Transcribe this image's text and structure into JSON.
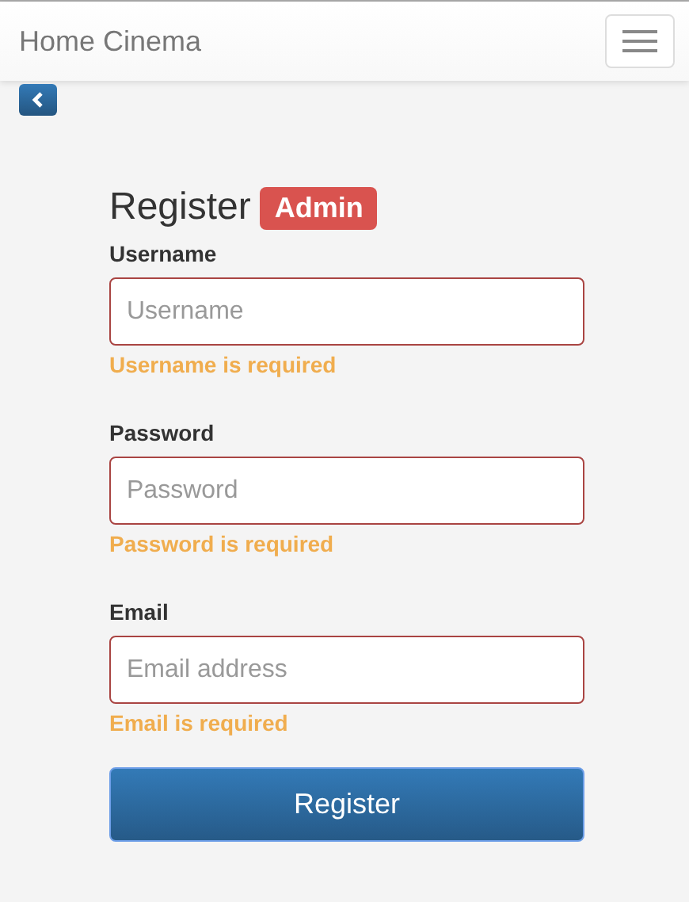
{
  "navbar": {
    "brand": "Home Cinema"
  },
  "form": {
    "title": "Register",
    "badge": "Admin",
    "fields": [
      {
        "label": "Username",
        "placeholder": "Username",
        "invalid": true,
        "error": "Username is required"
      },
      {
        "label": "Password",
        "placeholder": "Password",
        "invalid": true,
        "error": "Password is required"
      },
      {
        "label": "Email",
        "placeholder": "Email address",
        "invalid": true,
        "error": "Email is required"
      }
    ],
    "submit": "Register"
  }
}
